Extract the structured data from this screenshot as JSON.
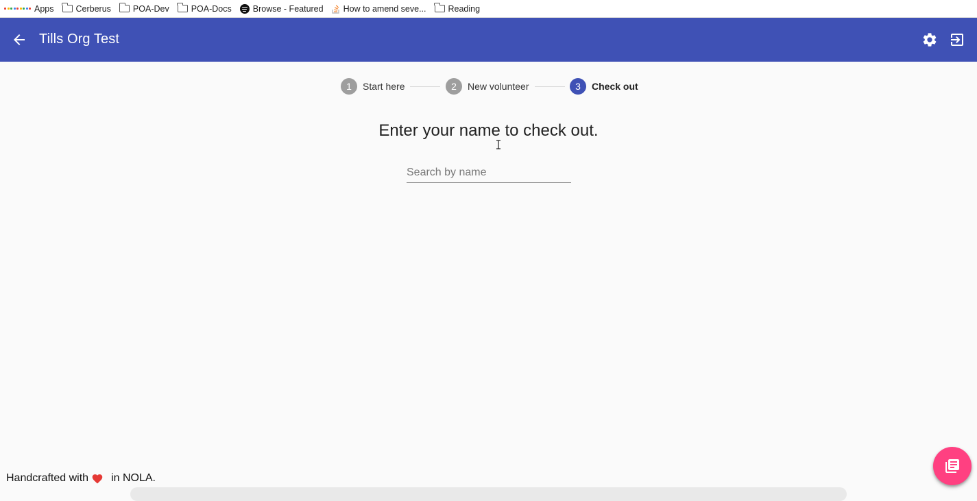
{
  "bookmarks": [
    {
      "label": "Apps",
      "icon": "apps-grid-icon"
    },
    {
      "label": "Cerberus",
      "icon": "folder-icon"
    },
    {
      "label": "POA-Dev",
      "icon": "folder-icon"
    },
    {
      "label": "POA-Docs",
      "icon": "folder-icon"
    },
    {
      "label": "Browse - Featured",
      "icon": "spotify-icon"
    },
    {
      "label": "How to amend seve...",
      "icon": "stackoverflow-icon"
    },
    {
      "label": "Reading",
      "icon": "folder-icon"
    }
  ],
  "appbar": {
    "title": "Tills Org Test",
    "back_icon": "arrow-back-icon",
    "settings_icon": "gear-icon",
    "exit_icon": "exit-to-app-icon",
    "color": "#3f51b5"
  },
  "stepper": {
    "steps": [
      {
        "number": "1",
        "label": "Start here",
        "active": false
      },
      {
        "number": "2",
        "label": "New volunteer",
        "active": false
      },
      {
        "number": "3",
        "label": "Check out",
        "active": true
      }
    ],
    "active_color": "#3f51b5",
    "inactive_color": "#9e9e9e"
  },
  "main": {
    "heading": "Enter your name to check out.",
    "search": {
      "placeholder": "Search by name",
      "value": ""
    }
  },
  "footer": {
    "prefix": "Handcrafted with",
    "suffix": "in NOLA.",
    "heart_icon": "heart-icon"
  },
  "fab": {
    "icon": "library-books-icon",
    "color": "#ff4081"
  }
}
